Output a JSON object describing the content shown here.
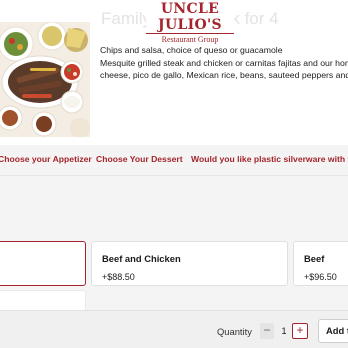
{
  "header": {
    "faded_title": "Family Fajita Pack for 4",
    "logo_main": "UNCLE JULIO'S",
    "logo_sub": "Restaurant Group"
  },
  "description": {
    "line1": "Chips and salsa, choice of queso or guacamole",
    "line2": "Mesquite grilled steak and chicken or carnitas fajitas and our homemade tortillas",
    "line3": "cheese, pico de gallo, Mexican rice, beans, sauteed peppers and onions"
  },
  "tabs": [
    {
      "label": "Choose your Appetizer"
    },
    {
      "label": "Choose Your Dessert"
    },
    {
      "label": "Would you like plastic silverware with your order?"
    }
  ],
  "options": [
    {
      "title": "",
      "price": "",
      "selected": true
    },
    {
      "title": "Beef and Chicken",
      "price": "+$88.50"
    },
    {
      "title": "Beef",
      "price": "+$96.50"
    }
  ],
  "footer": {
    "quantity_label": "Quantity",
    "minus": "−",
    "quantity": "1",
    "plus": "+",
    "add_label": "Add to Order"
  },
  "colors": {
    "accent": "#a4262c",
    "background": "#f4f4f4"
  }
}
